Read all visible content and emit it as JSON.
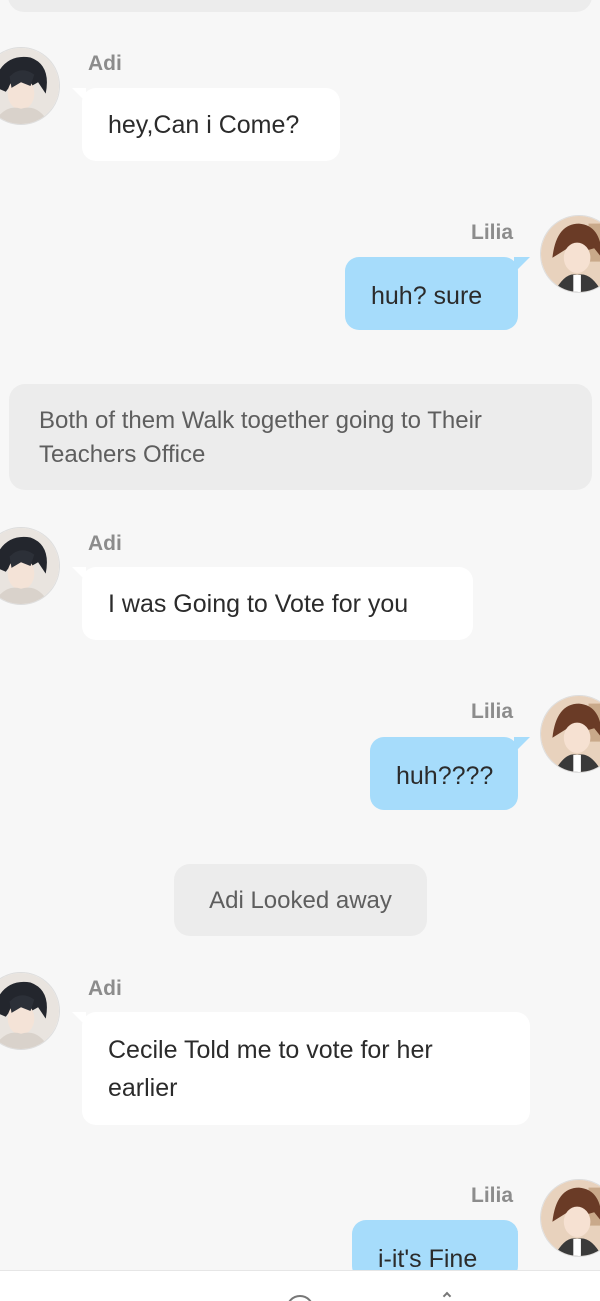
{
  "messages": [
    {
      "speaker": "Adi",
      "text": "hey,Can i Come?"
    },
    {
      "speaker": "Lilia",
      "text": "huh? sure"
    },
    {
      "narration": "Both of them Walk together going to Their Teachers Office"
    },
    {
      "speaker": "Adi",
      "text": "I was Going to Vote for you"
    },
    {
      "speaker": "Lilia",
      "text": "huh????"
    },
    {
      "narration": "Adi Looked away"
    },
    {
      "speaker": "Adi",
      "text": "Cecile Told me to vote for her earlier"
    },
    {
      "speaker": "Lilia",
      "text": "i-it's Fine"
    }
  ],
  "colors": {
    "background": "#f7f7f7",
    "left_bubble": "#ffffff",
    "right_bubble": "#a6dcfb",
    "narration": "#ececec",
    "name_text": "#8c8c8c"
  },
  "icons": [
    "adi-avatar-icon",
    "lilia-avatar-icon",
    "chat-input-icon",
    "chevron-up-icon"
  ]
}
